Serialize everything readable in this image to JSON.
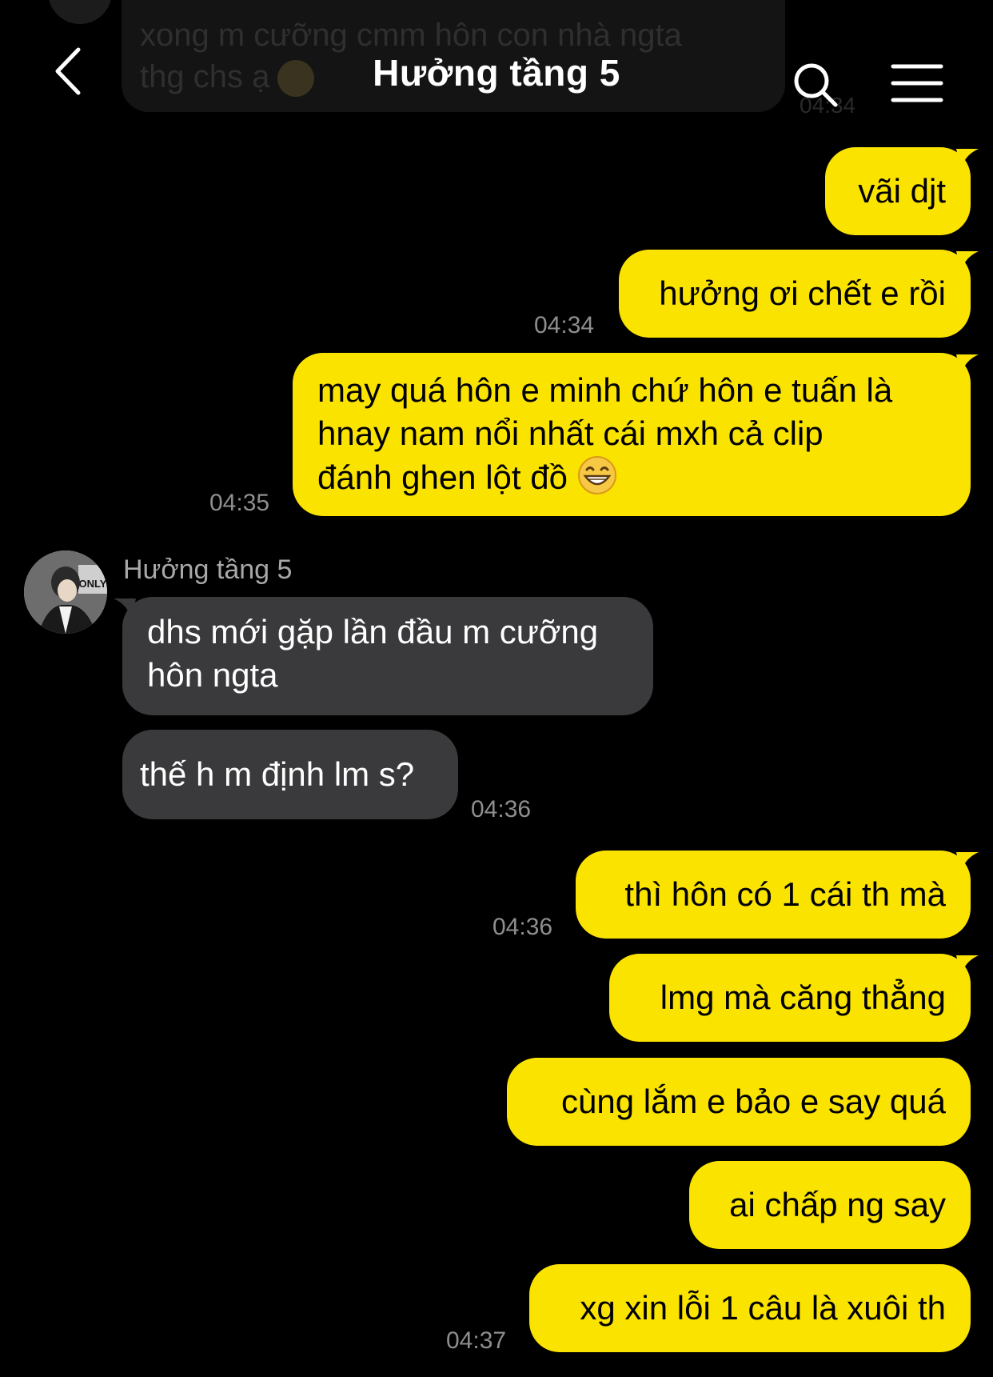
{
  "ghost": {
    "line1": "xong m cưỡng cmm hôn con nhà ngta",
    "line2": "thg chs ạ",
    "time": "04:34"
  },
  "header": {
    "title": "Hưởng tầng 5"
  },
  "contact": {
    "name": "Hưởng tầng 5",
    "avatar_text": "ONLY"
  },
  "messages": [
    {
      "dir": "out",
      "text": "vãi djt"
    },
    {
      "dir": "out",
      "text": "hưởng ơi chết e rồi",
      "time": "04:34"
    },
    {
      "dir": "out",
      "line1": "may quá hôn e minh chứ hôn e tuấn là",
      "line2": "hnay nam nổi nhất cái mxh cả clip",
      "line3": "đánh ghen lột đồ",
      "time": "04:35"
    },
    {
      "dir": "in",
      "line1": "dhs mới gặp lần đầu m cưỡng",
      "line2": "hôn ngta"
    },
    {
      "dir": "in",
      "text": "thế h m định lm s?",
      "time": "04:36"
    },
    {
      "dir": "out",
      "text": "thì hôn có 1 cái th mà",
      "time": "04:36"
    },
    {
      "dir": "out",
      "text": "lmg mà căng thẳng"
    },
    {
      "dir": "out",
      "text": "cùng lắm e bảo e say quá"
    },
    {
      "dir": "out",
      "text": "ai chấp ng say"
    },
    {
      "dir": "out",
      "text": "xg xin lỗi 1 câu là xuôi th",
      "time": "04:37"
    }
  ],
  "colors": {
    "outgoing": "#fbe300",
    "incoming": "#3a3a3c",
    "background": "#000000",
    "timestamp": "#8e8e8e"
  },
  "icons": {
    "back": "back-chevron-icon",
    "search": "search-icon",
    "menu": "menu-icon",
    "emoji": "grinning-emoji-icon"
  }
}
